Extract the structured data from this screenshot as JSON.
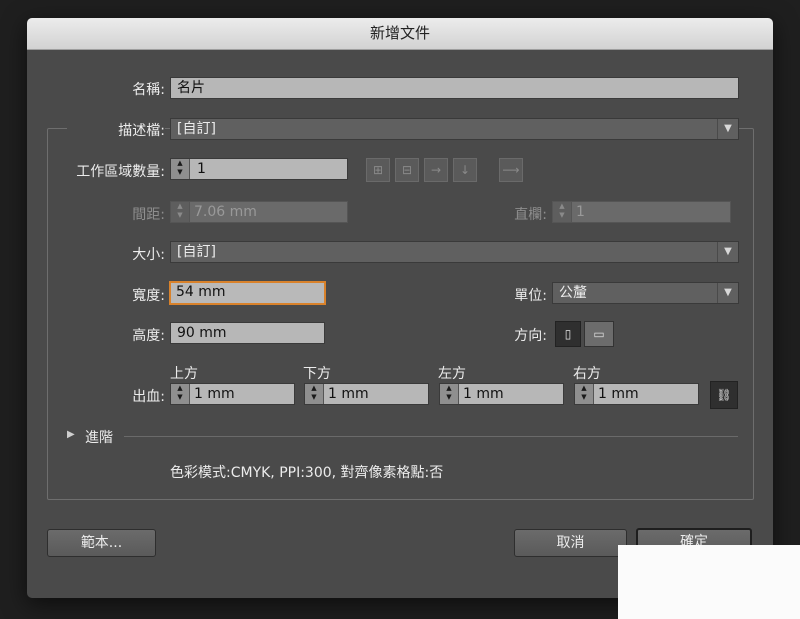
{
  "dialog": {
    "title": "新增文件",
    "name_label": "名稱:",
    "name_value": "名片",
    "profile_label": "描述檔:",
    "profile_value": "[自訂]",
    "artboards_label": "工作區域數量:",
    "artboards_value": "1",
    "spacing_label": "間距:",
    "spacing_value": "7.06 mm",
    "columns_label": "直欄:",
    "columns_value": "1",
    "size_label": "大小:",
    "size_value": "[自訂]",
    "width_label": "寬度:",
    "width_value": "54 mm",
    "units_label": "單位:",
    "units_value": "公釐",
    "height_label": "高度:",
    "height_value": "90 mm",
    "orientation_label": "方向:",
    "bleed_label": "出血:",
    "bleed_top_label": "上方",
    "bleed_top_value": "1 mm",
    "bleed_bottom_label": "下方",
    "bleed_bottom_value": "1 mm",
    "bleed_left_label": "左方",
    "bleed_left_value": "1 mm",
    "bleed_right_label": "右方",
    "bleed_right_value": "1 mm",
    "advanced_label": "進階",
    "summary": "色彩模式:CMYK, PPI:300, 對齊像素格點:否",
    "templates_button": "範本...",
    "cancel_button": "取消",
    "ok_button": "確定"
  },
  "icons": {
    "grid_row": "grid-by-row-icon",
    "grid_col": "grid-by-column-icon",
    "arrange_row": "arrange-by-row-icon",
    "arrange_col": "arrange-by-column-icon",
    "direction": "right-to-left-icon",
    "portrait": "portrait-icon",
    "landscape": "landscape-icon",
    "link": "link-icon",
    "disclosure": "disclosure-triangle-icon"
  },
  "colors": {
    "dialog_bg": "#4a4a4a",
    "focus_ring": "#d9822b",
    "field_bg": "#b7b7b7"
  }
}
